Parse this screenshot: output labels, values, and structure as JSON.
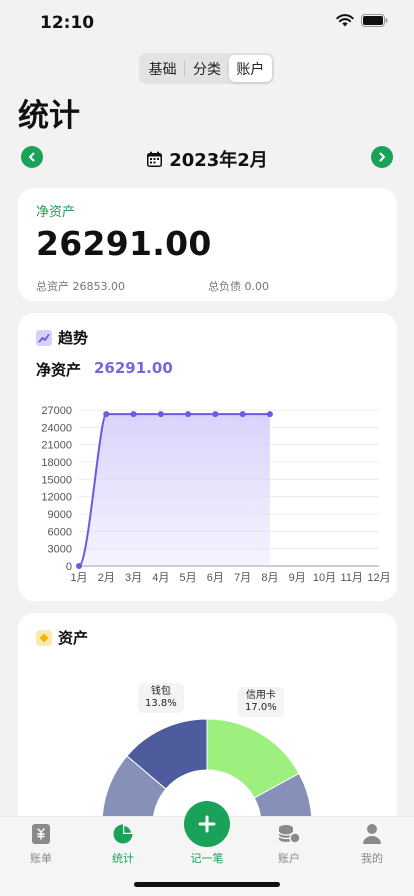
{
  "status_bar": {
    "time": "12:10"
  },
  "segments": [
    "基础",
    "分类",
    "账户"
  ],
  "active_segment": 2,
  "page_title": "统计",
  "month_nav": {
    "label": "2023年2月"
  },
  "net_worth": {
    "label": "净资产",
    "value": "26291.00",
    "total_assets": "总资产 26853.00",
    "total_liabilities": "总负债 0.00"
  },
  "trend": {
    "title": "趋势",
    "label": "净资产",
    "value": "26291.00",
    "line_color": "#6a5be0",
    "fill_color": "#d9d4fb"
  },
  "chart_data": [
    {
      "type": "area",
      "title": "",
      "x": [
        "1月",
        "2月",
        "3月",
        "4月",
        "5月",
        "6月",
        "7月",
        "8月",
        "9月",
        "10月",
        "11月",
        "12月"
      ],
      "values": [
        0,
        26291,
        26291,
        26291,
        26291,
        26291,
        26291,
        26291
      ],
      "yticks": [
        0,
        3000,
        6000,
        9000,
        12000,
        15000,
        18000,
        21000,
        24000,
        27000
      ],
      "ylim": [
        0,
        27000
      ],
      "grid": true
    },
    {
      "type": "pie",
      "title": "",
      "slices": [
        {
          "label": "钱包",
          "percent": 13.8,
          "color": "#4e5b9c"
        },
        {
          "label": "信用卡",
          "percent": 17.0,
          "color": "#9df07e"
        },
        {
          "label": "",
          "percent": 69.2,
          "color": "#8790b8"
        }
      ]
    }
  ],
  "assets": {
    "title": "资产",
    "tags": [
      {
        "name": "钱包",
        "percent": "13.8%"
      },
      {
        "name": "信用卡",
        "percent": "17.0%"
      }
    ]
  },
  "tabbar": {
    "items": [
      {
        "label": "账单",
        "icon": "bill-icon"
      },
      {
        "label": "统计",
        "icon": "pie-chart-icon"
      },
      {
        "label": "记一笔",
        "icon": "add-icon"
      },
      {
        "label": "账户",
        "icon": "coins-icon"
      },
      {
        "label": "我的",
        "icon": "person-icon"
      }
    ],
    "active_index": 1
  }
}
